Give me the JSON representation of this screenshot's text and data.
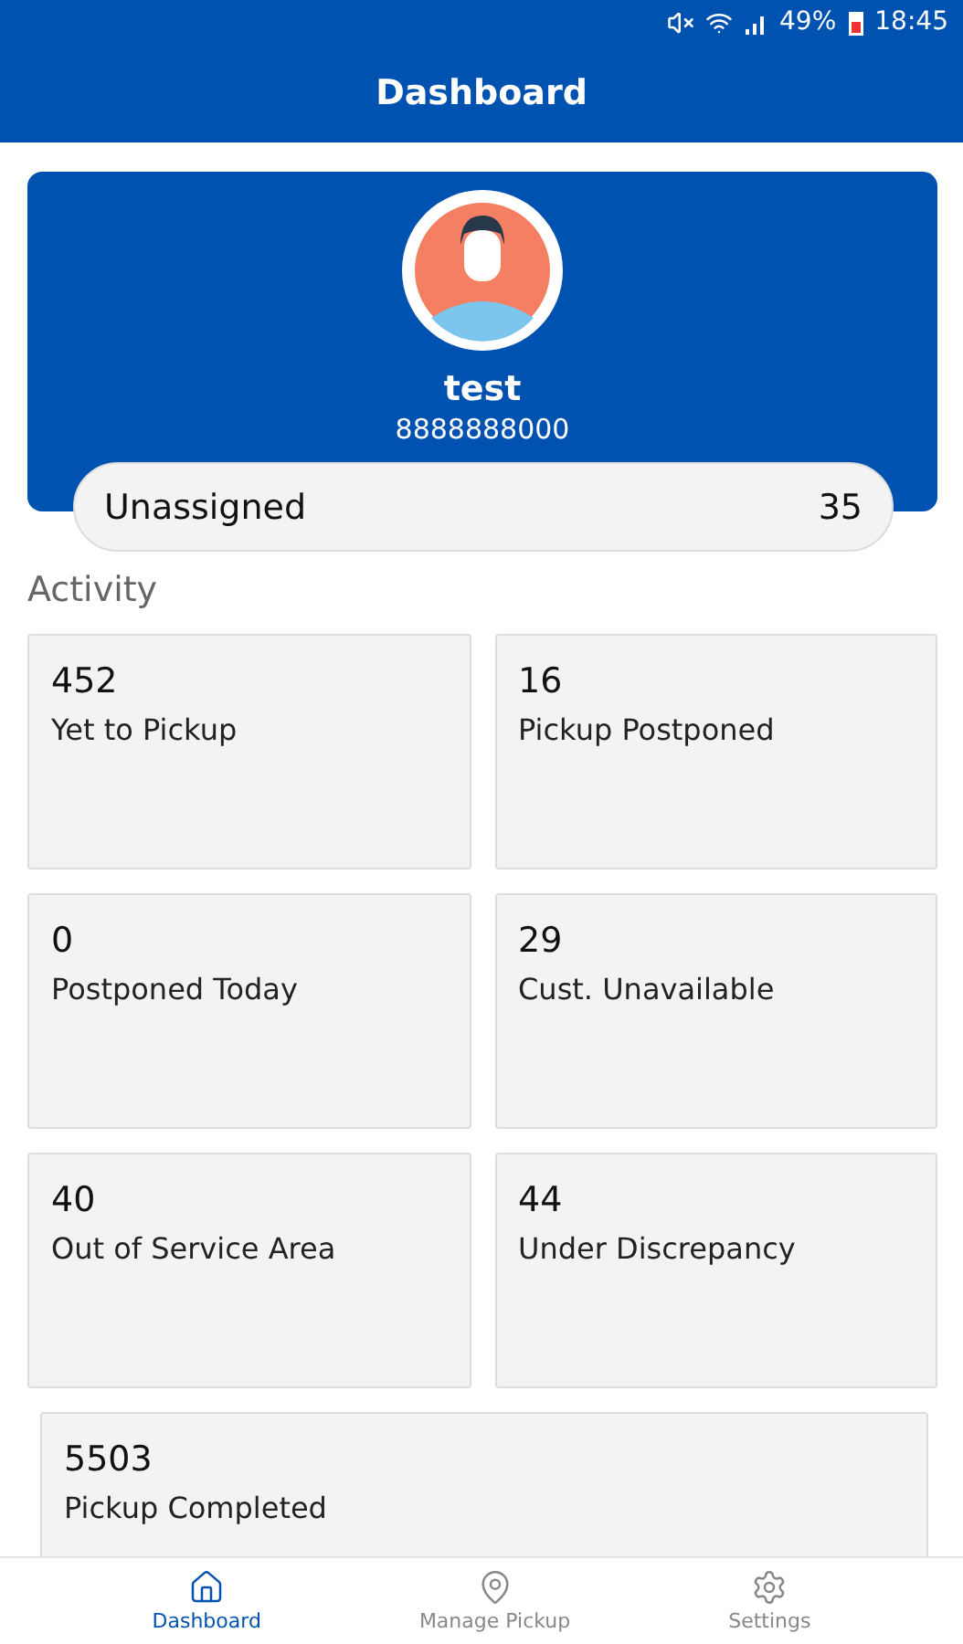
{
  "status_bar": {
    "battery": "49%",
    "time": "18:45"
  },
  "header": {
    "title": "Dashboard"
  },
  "profile": {
    "name": "test",
    "phone": "8888888000"
  },
  "unassigned": {
    "label": "Unassigned",
    "count": "35"
  },
  "activity": {
    "title": "Activity",
    "tiles": [
      {
        "count": "452",
        "label": "Yet to Pickup",
        "wide": false
      },
      {
        "count": "16",
        "label": "Pickup Postponed",
        "wide": false
      },
      {
        "count": "0",
        "label": "Postponed Today",
        "wide": false
      },
      {
        "count": "29",
        "label": "Cust. Unavailable",
        "wide": false
      },
      {
        "count": "40",
        "label": "Out of Service Area",
        "wide": false
      },
      {
        "count": "44",
        "label": "Under Discrepancy",
        "wide": false
      },
      {
        "count": "5503",
        "label": "Pickup Completed",
        "wide": true
      }
    ]
  },
  "nav": [
    {
      "kind": "home",
      "label": "Dashboard",
      "selected": true
    },
    {
      "kind": "pin",
      "label": "Manage Pickup",
      "selected": false
    },
    {
      "kind": "gear",
      "label": "Settings",
      "selected": false
    }
  ]
}
